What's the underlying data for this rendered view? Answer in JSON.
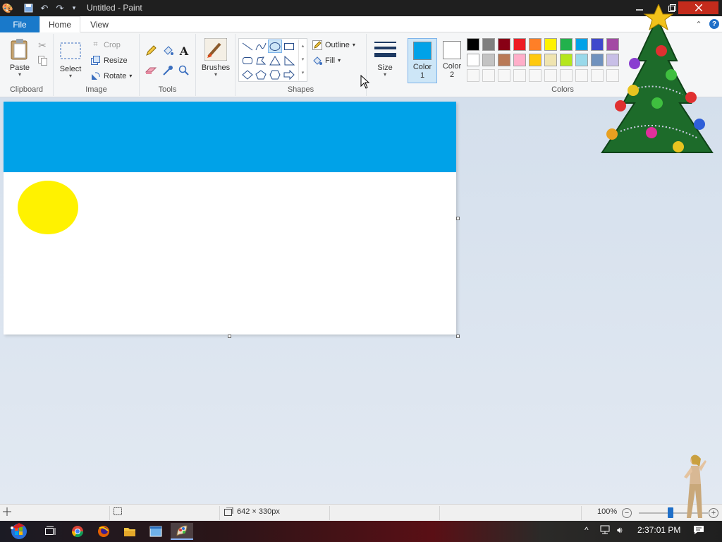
{
  "window": {
    "title": "Untitled - Paint",
    "min_icon": "minimize-icon",
    "max_icon": "restore-icon",
    "close_icon": "close-icon"
  },
  "tabs": {
    "file": "File",
    "home": "Home",
    "view": "View"
  },
  "clipboard": {
    "paste": "Paste",
    "label": "Clipboard"
  },
  "image": {
    "select": "Select",
    "crop": "Crop",
    "resize": "Resize",
    "rotate": "Rotate",
    "label": "Image"
  },
  "tools": {
    "label": "Tools",
    "text_glyph": "A"
  },
  "brushes": {
    "label": "Brushes"
  },
  "shapes": {
    "outline": "Outline",
    "fill": "Fill",
    "label": "Shapes",
    "selected": "oval"
  },
  "size": {
    "label": "Size"
  },
  "colors": {
    "color1_label": "Color",
    "color1_num": "1",
    "color2_label": "Color",
    "color2_num": "2",
    "color1": "#00a2e8",
    "color2": "#ffffff",
    "label": "Colors",
    "palette": [
      "#000000",
      "#7f7f7f",
      "#880015",
      "#ed1c24",
      "#ff7f27",
      "#fff200",
      "#22b14c",
      "#00a2e8",
      "#3f48cc",
      "#a349a4",
      "#ffffff",
      "#c3c3c3",
      "#b97a57",
      "#ffaec9",
      "#ffc90e",
      "#efe4b0",
      "#b5e61d",
      "#99d9ea",
      "#7092be",
      "#c8bfe7"
    ]
  },
  "canvas": {
    "band_color": "#00a2e8",
    "sun_color": "#fff200"
  },
  "status": {
    "size": "642 × 330px",
    "zoom": "100%"
  },
  "taskbar": {
    "time": "2:37:01 PM"
  }
}
